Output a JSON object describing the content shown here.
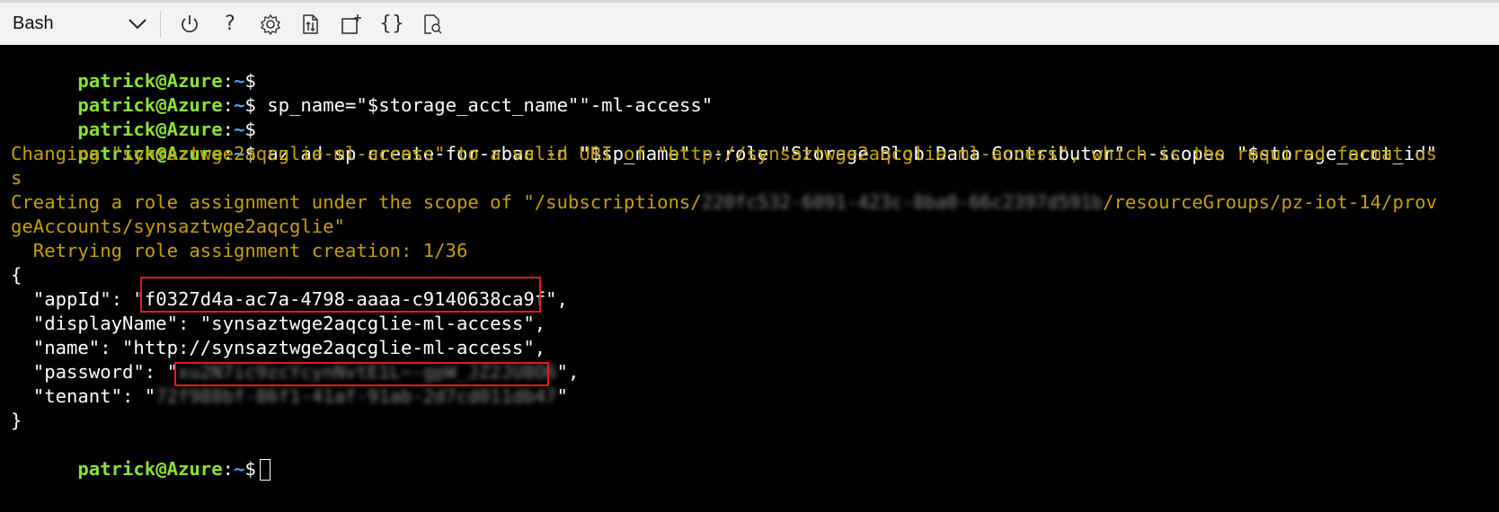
{
  "toolbar": {
    "shell_selector": "Bash",
    "buttons": [
      {
        "name": "power-icon",
        "tooltip": "Restart"
      },
      {
        "name": "help-icon",
        "glyph": "?"
      },
      {
        "name": "settings-icon"
      },
      {
        "name": "upload-download-icon"
      },
      {
        "name": "new-session-icon"
      },
      {
        "name": "editor-icon",
        "glyph": "{}"
      },
      {
        "name": "web-preview-icon"
      }
    ]
  },
  "terminal": {
    "prompt_user": "patrick@Azure",
    "prompt_colon": ":",
    "prompt_path": "~",
    "prompt_dollar": "$",
    "lines": {
      "cmd1": "",
      "cmd2": " sp_name=\"$storage_acct_name\"\"-ml-access\"",
      "cmd3": "",
      "cmd4": " az ad sp create-for-rbac -n \"$sp_name\" --role \"Storage Blob Data Contributor\" --scopes \"$storage_acct_id\"",
      "warn1": "Changing \"synsaztwge2aqcglie-ml-access\" to a valid URI of \"http://synsaztwge2aqcglie-ml-access\", which is the required format us",
      "warn2": "s",
      "warn3a": "Creating a role assignment under the scope of \"/subscriptions/",
      "warn3_blur": "220fc532-6091-423c-8ba0-66c2397d591b",
      "warn3b": "/resourceGroups/pz-iot-14/prov",
      "warn4": "geAccounts/synsaztwge2aqcglie\"",
      "warn5": "  Retrying role assignment creation: 1/36",
      "json_open": "{",
      "appid_key": "  \"appId\": \"",
      "appid_val": "f0327d4a-ac7a-4798-aaaa-c9140638ca9f",
      "appid_end": "\",",
      "display": "  \"displayName\": \"synsaztwge2aqcglie-ml-access\",",
      "name": "  \"name\": \"http://synsaztwge2aqcglie-ml-access\",",
      "pw_key": "  \"password\": \"",
      "pw_blur": "xu2N7ic9zcYcynNvtE1L~-gpW_JZ2JU8O6",
      "pw_end": "\",",
      "tenant_key": "  \"tenant\": \"",
      "tenant_blur": "72f988bf-86f1-41af-91ab-2d7cd011db47",
      "tenant_end": "\"",
      "json_close": "}"
    }
  }
}
